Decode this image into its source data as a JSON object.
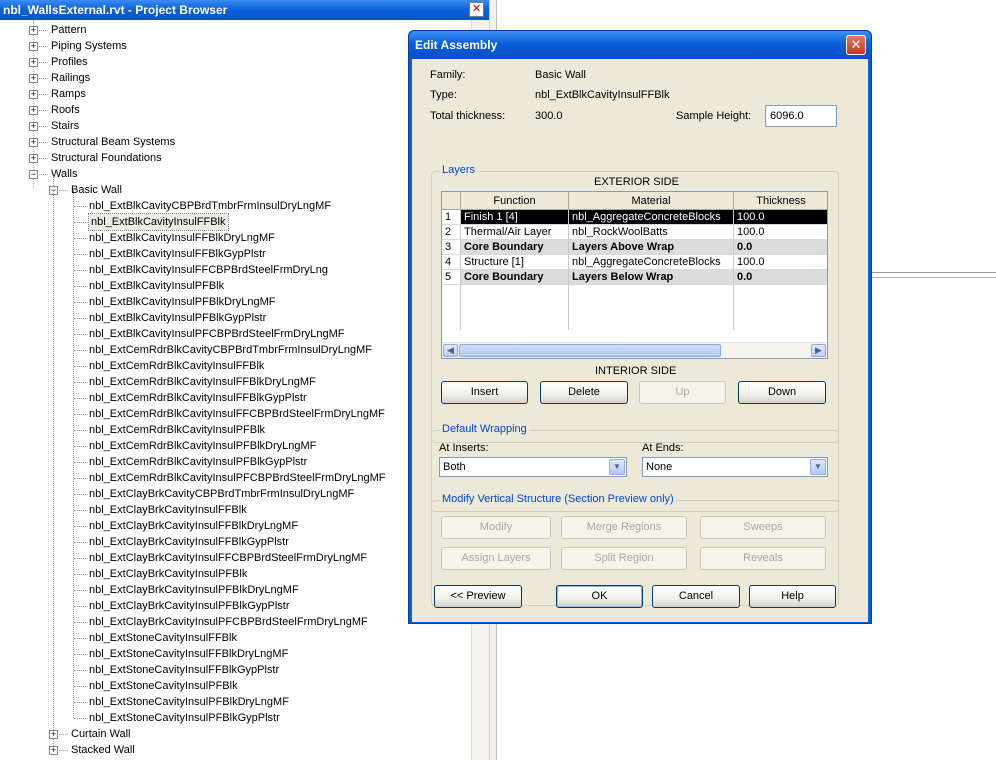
{
  "project_browser": {
    "title": "nbl_WallsExternal.rvt - Project Browser",
    "close_glyph": "✕",
    "top_items": [
      "Pattern",
      "Piping Systems",
      "Profiles",
      "Railings",
      "Ramps",
      "Roofs",
      "Stairs",
      "Structural Beam Systems",
      "Structural Foundations",
      "Walls"
    ],
    "walls_children": [
      "Basic Wall"
    ],
    "basic_wall_types": [
      "nbl_ExtBlkCavityCBPBrdTmbrFrmInsulDryLngMF",
      "nbl_ExtBlkCavityInsulFFBlk",
      "nbl_ExtBlkCavityInsulFFBlkDryLngMF",
      "nbl_ExtBlkCavityInsulFFBlkGypPlstr",
      "nbl_ExtBlkCavityInsulFFCBPBrdSteelFrmDryLng",
      "nbl_ExtBlkCavityInsulPFBlk",
      "nbl_ExtBlkCavityInsulPFBlkDryLngMF",
      "nbl_ExtBlkCavityInsulPFBlkGypPlstr",
      "nbl_ExtBlkCavityInsulPFCBPBrdSteelFrmDryLngMF",
      "nbl_ExtCemRdrBlkCavityCBPBrdTmbrFrmInsulDryLngMF",
      "nbl_ExtCemRdrBlkCavityInsulFFBlk",
      "nbl_ExtCemRdrBlkCavityInsulFFBlkDryLngMF",
      "nbl_ExtCemRdrBlkCavityInsulFFBlkGypPlstr",
      "nbl_ExtCemRdrBlkCavityInsulFFCBPBrdSteelFrmDryLngMF",
      "nbl_ExtCemRdrBlkCavityInsulPFBlk",
      "nbl_ExtCemRdrBlkCavityInsulPFBlkDryLngMF",
      "nbl_ExtCemRdrBlkCavityInsulPFBlkGypPlstr",
      "nbl_ExtCemRdrBlkCavityInsulPFCBPBrdSteelFrmDryLngMF",
      "nbl_ExtClayBrkCavityCBPBrdTmbrFrmInsulDryLngMF",
      "nbl_ExtClayBrkCavityInsulFFBlk",
      "nbl_ExtClayBrkCavityInsulFFBlkDryLngMF",
      "nbl_ExtClayBrkCavityInsulFFBlkGypPlstr",
      "nbl_ExtClayBrkCavityInsulFFCBPBrdSteelFrmDryLngMF",
      "nbl_ExtClayBrkCavityInsulPFBlk",
      "nbl_ExtClayBrkCavityInsulPFBlkDryLngMF",
      "nbl_ExtClayBrkCavityInsulPFBlkGypPlstr",
      "nbl_ExtClayBrkCavityInsulPFCBPBrdSteelFrmDryLngMF",
      "nbl_ExtStoneCavityInsulFFBlk",
      "nbl_ExtStoneCavityInsulFFBlkDryLngMF",
      "nbl_ExtStoneCavityInsulFFBlkGypPlstr",
      "nbl_ExtStoneCavityInsulPFBlk",
      "nbl_ExtStoneCavityInsulPFBlkDryLngMF",
      "nbl_ExtStoneCavityInsulPFBlkGypPlstr"
    ],
    "selected_type": "nbl_ExtBlkCavityInsulFFBlk",
    "bottom_items": [
      "Curtain Wall",
      "Stacked Wall"
    ],
    "expand_glyph": "+",
    "collapse_glyph": "−"
  },
  "dialog": {
    "title": "Edit Assembly",
    "close_glyph": "✕",
    "family_label": "Family:",
    "family_value": "Basic Wall",
    "type_label": "Type:",
    "type_value": "nbl_ExtBlkCavityInsulFFBlk",
    "thickness_label": "Total thickness:",
    "thickness_value": "300.0",
    "sample_height_label": "Sample Height:",
    "sample_height_value": "6096.0",
    "layers_group": "Layers",
    "exterior_side": "EXTERIOR SIDE",
    "interior_side": "INTERIOR SIDE",
    "columns": [
      "",
      "Function",
      "Material",
      "Thickness"
    ],
    "layers": [
      {
        "num": "1",
        "function": "Finish 1 [4]",
        "material": "nbl_AggregateConcreteBlocks",
        "thickness": "100.0",
        "state": "selected"
      },
      {
        "num": "2",
        "function": "Thermal/Air Layer",
        "material": "nbl_RockWoolBatts",
        "thickness": "100.0",
        "state": "normal"
      },
      {
        "num": "3",
        "function": "Core Boundary",
        "material": "Layers Above Wrap",
        "thickness": "0.0",
        "state": "bold"
      },
      {
        "num": "4",
        "function": "Structure [1]",
        "material": "nbl_AggregateConcreteBlocks",
        "thickness": "100.0",
        "state": "normal"
      },
      {
        "num": "5",
        "function": "Core Boundary",
        "material": "Layers Below Wrap",
        "thickness": "0.0",
        "state": "bold"
      }
    ],
    "scroll_left": "◀",
    "scroll_right": "▶",
    "buttons_layers": {
      "insert": "Insert",
      "delete": "Delete",
      "up": "Up",
      "down": "Down"
    },
    "wrapping_group": "Default Wrapping",
    "at_inserts_label": "At Inserts:",
    "at_inserts_value": "Both",
    "at_ends_label": "At Ends:",
    "at_ends_value": "None",
    "dropdown_glyph": "▼",
    "modify_group": "Modify Vertical Structure (Section Preview only)",
    "buttons_modify": {
      "modify": "Modify",
      "merge": "Merge Regions",
      "sweeps": "Sweeps",
      "assign": "Assign Layers",
      "split": "Split Region",
      "reveals": "Reveals"
    },
    "buttons_footer": {
      "preview": "<< Preview",
      "ok": "OK",
      "cancel": "Cancel",
      "help": "Help"
    }
  }
}
